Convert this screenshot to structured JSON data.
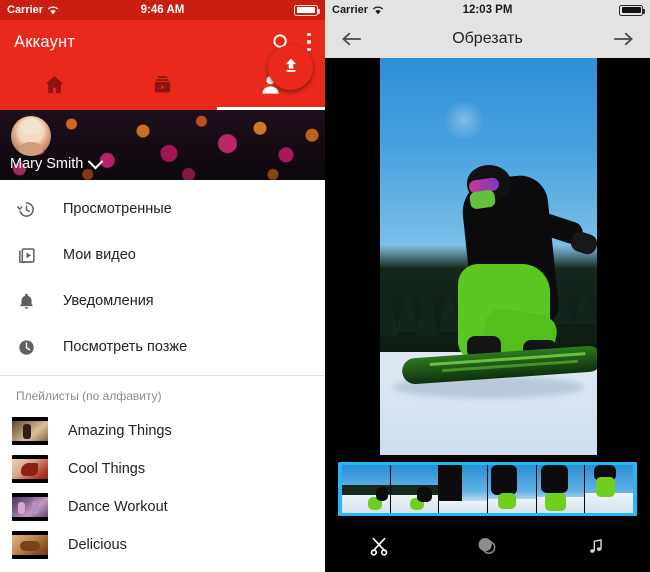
{
  "left_panel": {
    "status_bar": {
      "carrier": "Carrier",
      "wifi_icon": "wifi-icon",
      "time": "9:46 AM",
      "battery_icon": "battery-full-icon"
    },
    "app_bar": {
      "title": "Аккаунт",
      "search_icon": "search-icon",
      "overflow_icon": "more-vertical-icon"
    },
    "tabs": [
      {
        "name": "home",
        "icon": "home-icon",
        "active": false
      },
      {
        "name": "subscriptions",
        "icon": "subscriptions-icon",
        "active": false
      },
      {
        "name": "account",
        "icon": "person-icon",
        "active": true
      }
    ],
    "profile": {
      "username": "Mary Smith",
      "dropdown_icon": "chevron-down-icon",
      "avatar_icon": "avatar",
      "upload_fab_icon": "upload-icon"
    },
    "menu_items": [
      {
        "label": "Просмотренные",
        "icon": "history-icon"
      },
      {
        "label": "Мои видео",
        "icon": "my-videos-icon"
      },
      {
        "label": "Уведомления",
        "icon": "bell-icon"
      },
      {
        "label": "Посмотреть позже",
        "icon": "clock-icon"
      }
    ],
    "playlists_section": {
      "header": "Плейлисты (по алфавиту)",
      "items": [
        {
          "label": "Amazing Things",
          "thumb": "playlist-thumb-amazing-things"
        },
        {
          "label": "Cool Things",
          "thumb": "playlist-thumb-cool-things"
        },
        {
          "label": "Dance Workout",
          "thumb": "playlist-thumb-dance-workout"
        },
        {
          "label": "Delicious",
          "thumb": "playlist-thumb-delicious"
        }
      ]
    },
    "colors": {
      "accent": "#e8291c",
      "status_bar": "#c91e10",
      "text": "#222222"
    }
  },
  "right_panel": {
    "status_bar": {
      "carrier": "Carrier",
      "wifi_icon": "wifi-icon",
      "time": "12:03 PM",
      "battery_icon": "battery-full-icon"
    },
    "app_bar": {
      "back_icon": "arrow-left-icon",
      "title": "Обрезать",
      "next_icon": "arrow-right-icon"
    },
    "video_preview": {
      "name": "video-preview",
      "content": "snowboarder-on-snowy-slope"
    },
    "filmstrip": {
      "name": "trim-filmstrip",
      "frames": [
        "frame-1",
        "frame-2",
        "frame-3",
        "frame-4",
        "frame-5",
        "frame-6"
      ],
      "selection_color": "#29b6f6"
    },
    "toolbar": [
      {
        "name": "trim-tool",
        "icon": "scissors-icon",
        "active": true
      },
      {
        "name": "filter-tool",
        "icon": "filter-circles-icon",
        "active": false
      },
      {
        "name": "music-tool",
        "icon": "music-note-icon",
        "active": false
      }
    ],
    "colors": {
      "background": "#000000",
      "status_bar": "#e3e3e1",
      "app_bar": "#e3e3e1"
    }
  }
}
